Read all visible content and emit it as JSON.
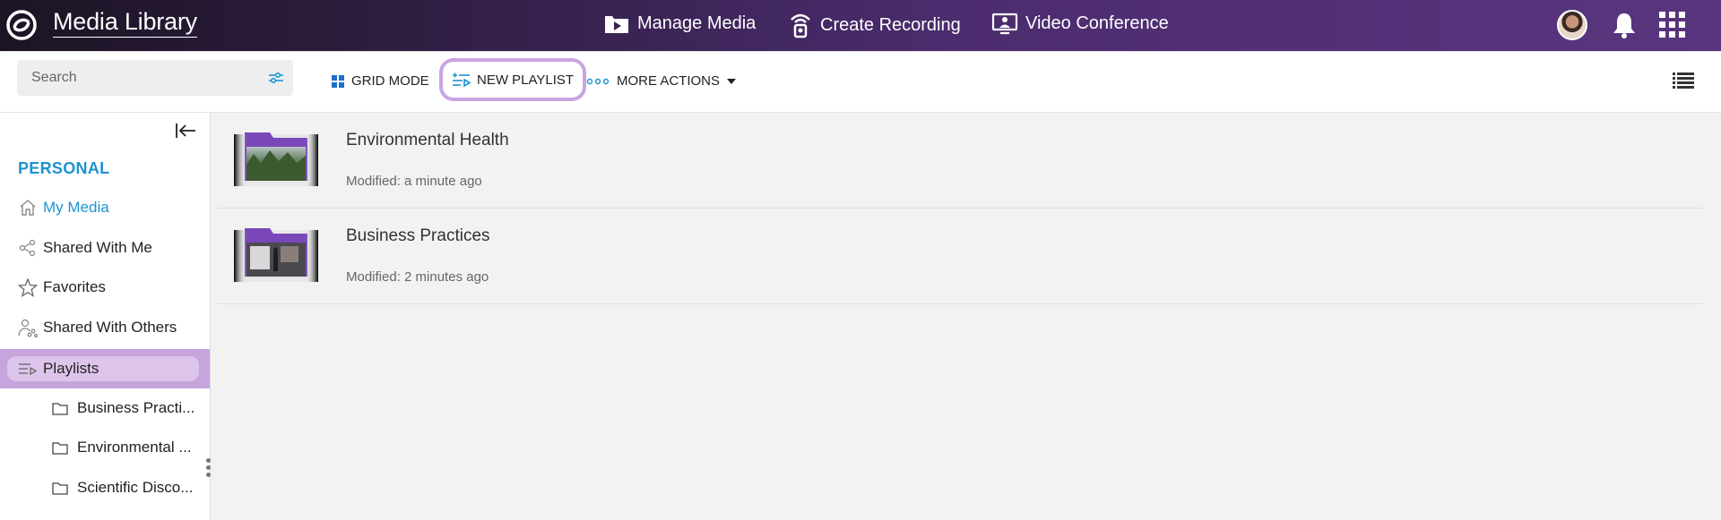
{
  "header": {
    "app_title": "Media Library",
    "nav": [
      {
        "label": "Manage Media",
        "icon": "folder-play-icon"
      },
      {
        "label": "Create Recording",
        "icon": "recording-icon"
      },
      {
        "label": "Video Conference",
        "icon": "video-conference-icon"
      }
    ]
  },
  "toolbar": {
    "search_placeholder": "Search",
    "grid_mode_label": "GRID MODE",
    "new_playlist_label": "NEW PLAYLIST",
    "more_actions_label": "MORE ACTIONS"
  },
  "sidebar": {
    "section_title": "PERSONAL",
    "items": [
      {
        "label": "My Media",
        "icon": "home-icon",
        "active": true
      },
      {
        "label": "Shared With Me",
        "icon": "share-icon"
      },
      {
        "label": "Favorites",
        "icon": "star-icon"
      },
      {
        "label": "Shared With Others",
        "icon": "shared-user-icon"
      },
      {
        "label": "Playlists",
        "icon": "playlist-icon"
      }
    ],
    "playlists": [
      {
        "label": "Business Practi..."
      },
      {
        "label": "Environmental ..."
      },
      {
        "label": "Scientific Disco..."
      }
    ]
  },
  "content": {
    "items": [
      {
        "title": "Environmental Health",
        "modified": "Modified: a minute ago"
      },
      {
        "title": "Business Practices",
        "modified": "Modified: 2 minutes ago"
      }
    ]
  },
  "colors": {
    "accent_blue": "#1d93d2",
    "highlight_purple": "#c6a4dd",
    "folder_purple": "#7a47b8"
  }
}
